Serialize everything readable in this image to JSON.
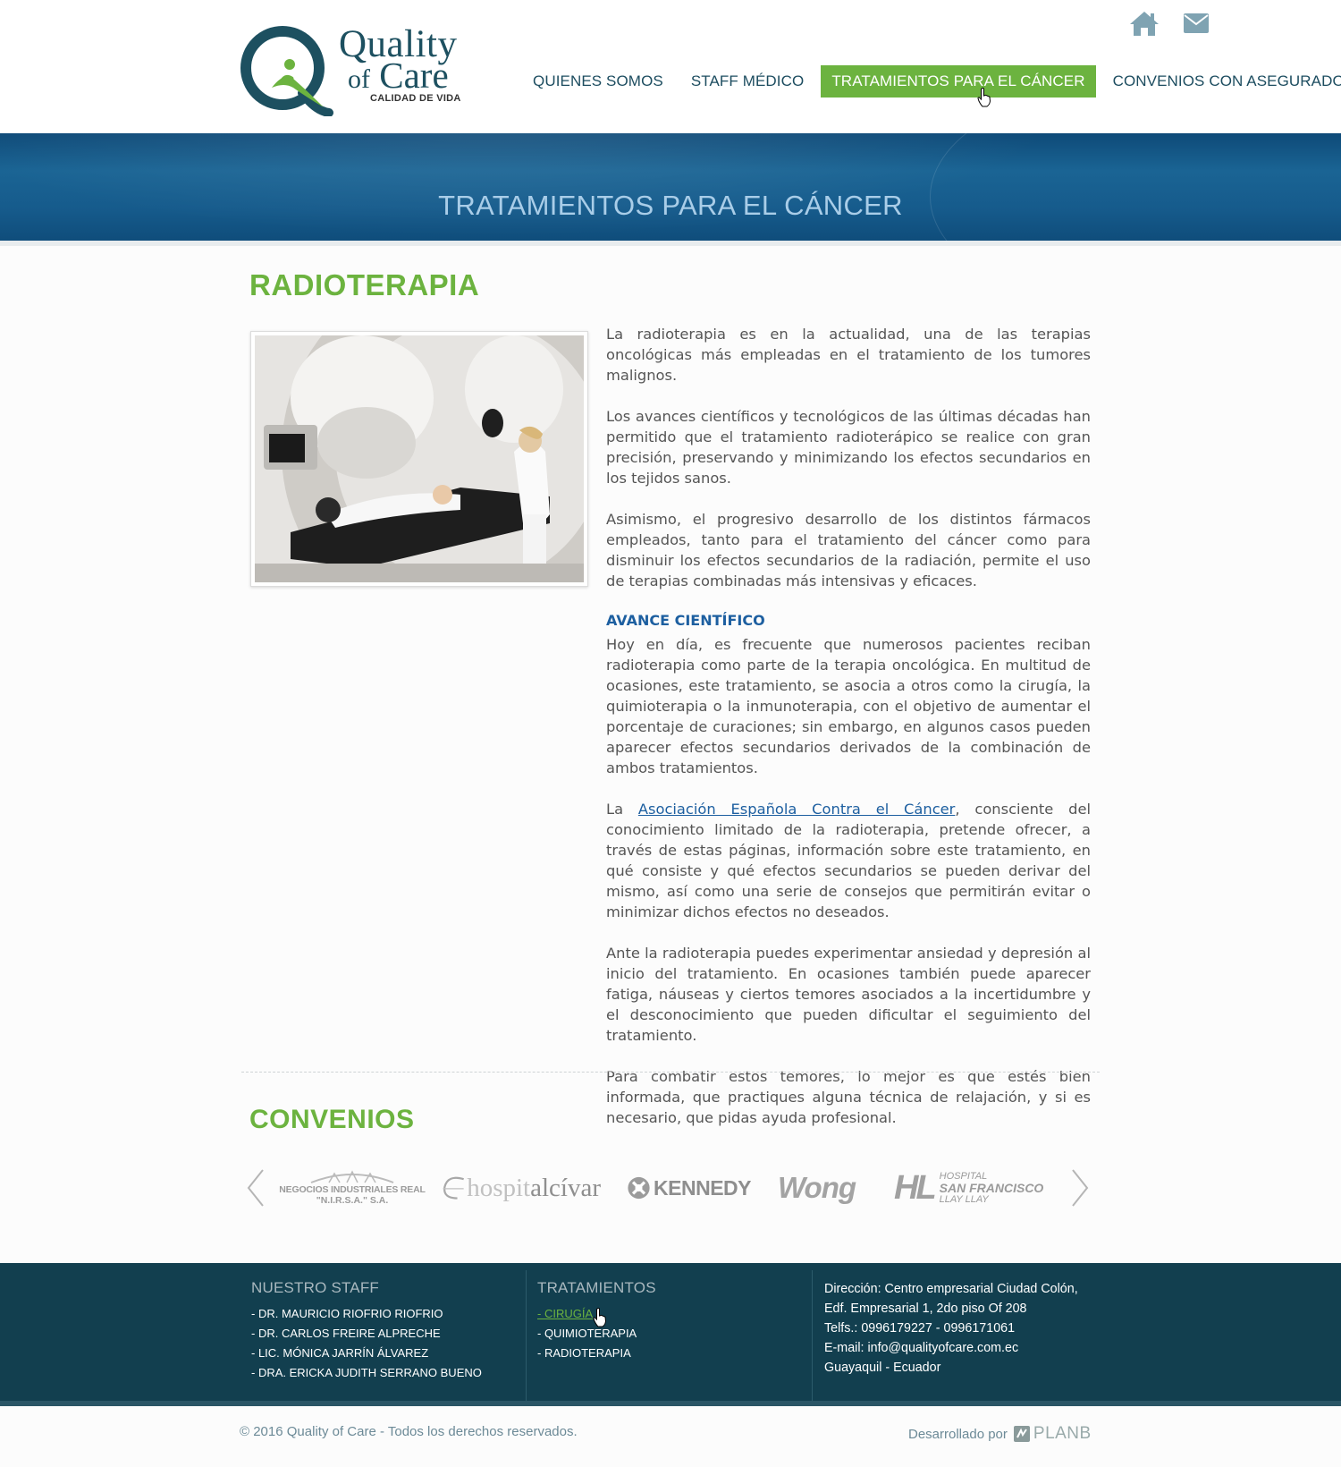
{
  "brand": {
    "name_line1": "Quality",
    "name_of": "of",
    "name_line2": "Care",
    "tagline": "CALIDAD DE VIDA",
    "green": "#6cb33f",
    "teal": "#1d5060"
  },
  "top_icons": [
    "home-icon",
    "mail-icon"
  ],
  "nav": {
    "items": [
      {
        "label": "QUIENES SOMOS",
        "active": false
      },
      {
        "label": "STAFF MÉDICO",
        "active": false
      },
      {
        "label": "TRATAMIENTOS PARA EL CÁNCER",
        "active": true
      },
      {
        "label": "CONVENIOS CON ASEGURADOS",
        "active": false
      }
    ]
  },
  "banner": {
    "title": "TRATAMIENTOS PARA EL CÁNCER"
  },
  "main": {
    "heading": "RADIOTERAPIA",
    "image_alt": "radiotherapy-machine-photo",
    "paragraphs": [
      "La radioterapia es en la actualidad, una de las terapias oncológicas más empleadas en el tratamiento de los tumores malignos.",
      "Los avances científicos y tecnológicos de las últimas décadas han permitido que el tratamiento radioterápico se realice con gran precisión, preservando y minimizando los efectos secundarios en los tejidos sanos.",
      "Asimismo, el progresivo desarrollo de los distintos fármacos empleados, tanto para el tratamiento del cáncer como para disminuir los efectos secundarios de la radiación, permite el uso de terapias combinadas más intensivas y eficaces."
    ],
    "subheading": "AVANCE CIENTÍFICO",
    "paragraphs2_first": "Hoy en día, es frecuente que numerosos pacientes reciban radioterapia como parte de la terapia oncológica. En multitud de ocasiones, este tratamiento, se asocia a otros como la cirugía, la quimioterapia o la inmunoterapia, con el objetivo de aumentar el porcentaje de curaciones; sin embargo, en algunos casos pueden aparecer efectos secundarios derivados de la combinación de ambos tratamientos.",
    "link_para": {
      "before": "La ",
      "link_text": "Asociación Española Contra el Cáncer",
      "after": ", consciente del conocimiento limitado de la radioterapia, pretende ofrecer, a través de estas páginas, información sobre este tratamiento, en qué consiste y qué efectos secundarios se pueden derivar del mismo, así como una serie de consejos que permitirán evitar o minimizar dichos efectos no deseados."
    },
    "paragraphs3": [
      "Ante la radioterapia puedes experimentar ansiedad y depresión al inicio del tratamiento. En ocasiones también puede aparecer fatiga, náuseas y ciertos temores asociados a la incertidumbre y el desconocimiento que pueden dificultar el seguimiento del tratamiento.",
      "Para combatir estos temores, lo mejor es que estés bien informada, que practiques alguna técnica de relajación, y si es necesario, que pidas ayuda profesional."
    ]
  },
  "convenios": {
    "heading": "CONVENIOS",
    "sponsors": [
      {
        "name": "NEGOCIOS INDUSTRIALES REAL",
        "sub": "\"N.I.R.S.A.\" S.A."
      },
      {
        "name_a": "hospit",
        "name_b": "alcívar"
      },
      {
        "name": "KENNEDY"
      },
      {
        "name": "Wong"
      },
      {
        "line1": "HOSPITAL",
        "line2": "SAN FRANCISCO",
        "line3": "LLAY LLAY",
        "mark": "HL"
      }
    ]
  },
  "footer": {
    "staff_title": "NUESTRO STAFF",
    "staff": [
      "- DR. MAURICIO RIOFRIO RIOFRIO",
      "- DR. CARLOS FREIRE ALPRECHE",
      "- LIC. MÓNICA JARRÍN ÁLVAREZ",
      "- DRA. ERICKA JUDITH SERRANO BUENO"
    ],
    "treat_title": "TRATAMIENTOS",
    "treatments": [
      "- CIRUGÍA",
      "- QUIMIOTERAPIA",
      "- RADIOTERAPIA"
    ],
    "address": [
      "Dirección: Centro empresarial Ciudad Colón,",
      "Edf. Empresarial 1, 2do piso Of 208",
      "Telfs.: 0996179227 - 0996171061",
      "E-mail: info@qualityofcare.com.ec",
      "Guayaquil - Ecuador"
    ]
  },
  "bottom": {
    "copyright": "© 2016 Quality of Care  -  Todos los derechos reservados.",
    "dev_label": "Desarrollado por",
    "dev_brand": "PLANB"
  }
}
